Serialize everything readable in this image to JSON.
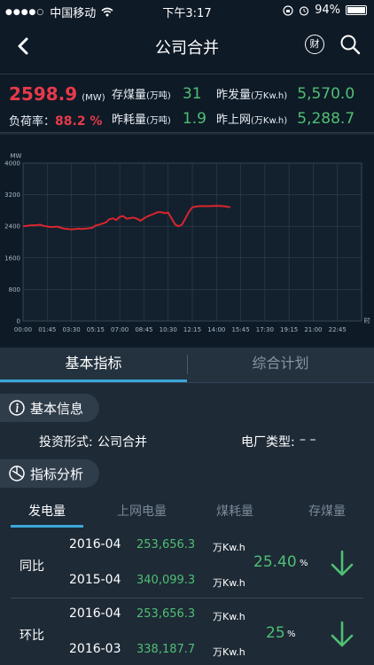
{
  "status_bar": {
    "carrier": "中国移动",
    "time": "下午3:17",
    "battery": "94%",
    "signal_icon": "signal-dots-icon",
    "wifi_icon": "wifi-icon"
  },
  "nav": {
    "title": "公司合并",
    "cai_label": "财"
  },
  "stats": {
    "load_value": "2598.9",
    "load_unit": "(MW)",
    "load_rate_label": "负荷率：",
    "load_rate_value": "88.2 %",
    "coal_stock_label": "存煤量",
    "coal_stock_unit": "(万吨)",
    "coal_stock_value": "31",
    "coal_used_label": "昨耗量",
    "coal_used_unit": "(万吨)",
    "coal_used_value": "1.9",
    "gen_label": "昨发量",
    "gen_unit": "(万Kw.h)",
    "gen_value": "5,570.0",
    "grid_label": "昨上网",
    "grid_unit": "(万Kw.h)",
    "grid_value": "5,288.7"
  },
  "chart_data": {
    "type": "line",
    "ylabel": "MW",
    "xlabel": "时",
    "ylim": [
      0,
      4000
    ],
    "yticks": [
      "0",
      "800",
      "1600",
      "2400",
      "3200",
      "4000"
    ],
    "xticks": [
      "00:00",
      "01:45",
      "03:30",
      "05:15",
      "07:00",
      "08:45",
      "10:30",
      "12:15",
      "14:00",
      "15:45",
      "17:30",
      "19:15",
      "21:00",
      "22:45"
    ],
    "grid": true,
    "color": "#d9252f",
    "series": [
      {
        "x": [
          0,
          0.5,
          1,
          1.25,
          1.5,
          2,
          2.5,
          2.75,
          3,
          3.5,
          4,
          4.25,
          4.5,
          5,
          5.25,
          5.5,
          6,
          6.25,
          6.5,
          6.75,
          7,
          7.25,
          7.5,
          8,
          8.25,
          8.5,
          8.75,
          9,
          9.5,
          9.75,
          10,
          10.25,
          10.5,
          10.75,
          11,
          11.25,
          11.5,
          12,
          12.25,
          12.5,
          12.75,
          13,
          13.5,
          14,
          14.5,
          15
        ],
        "y": [
          2400,
          2420,
          2430,
          2440,
          2410,
          2380,
          2390,
          2360,
          2340,
          2320,
          2340,
          2330,
          2340,
          2360,
          2420,
          2440,
          2500,
          2580,
          2600,
          2560,
          2640,
          2660,
          2590,
          2620,
          2590,
          2540,
          2600,
          2650,
          2720,
          2760,
          2760,
          2730,
          2750,
          2600,
          2450,
          2400,
          2440,
          2760,
          2880,
          2900,
          2910,
          2910,
          2910,
          2920,
          2910,
          2880
        ]
      }
    ]
  },
  "tabs": {
    "basic": "基本指标",
    "plan": "综合计划"
  },
  "basic_info": {
    "title": "基本信息",
    "invest_label": "投资形式:",
    "invest_value": "公司合并",
    "plant_type_label": "电厂类型:",
    "plant_type_value": "– –"
  },
  "indicator": {
    "title": "指标分析",
    "tabs": [
      "发电量",
      "上网电量",
      "煤耗量",
      "存煤量"
    ]
  },
  "comparisons": [
    {
      "label": "同比",
      "rows": [
        {
          "date": "2016-04",
          "value": "253,656.3",
          "unit": "万Kw.h"
        },
        {
          "date": "2015-04",
          "value": "340,099.3",
          "unit": "万Kw.h"
        }
      ],
      "pct": "25.40",
      "pct_unit": "%",
      "arrow_color": "#4fbf74"
    },
    {
      "label": "环比",
      "rows": [
        {
          "date": "2016-04",
          "value": "253,656.3",
          "unit": "万Kw.h"
        },
        {
          "date": "2016-03",
          "value": "338,187.7",
          "unit": "万Kw.h"
        }
      ],
      "pct": "25",
      "pct_unit": "%",
      "arrow_color": "#4fbf74"
    }
  ]
}
